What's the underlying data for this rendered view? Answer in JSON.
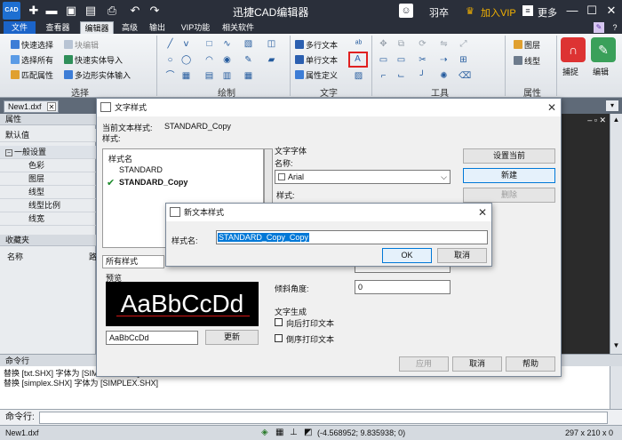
{
  "app": {
    "logo": "CAD",
    "title": "迅捷CAD编辑器",
    "user": "羽卒",
    "vip": "加入VIP",
    "more": "更多"
  },
  "menu_tabs": [
    "文件",
    "查看器",
    "编辑器",
    "高级",
    "输出",
    "VIP功能",
    "相关软件"
  ],
  "ribbon": {
    "select_group": {
      "label": "选择",
      "items": [
        "快速选择",
        "选择所有",
        "匹配属性",
        "块编辑",
        "快速实体导入",
        "多边形实体输入"
      ]
    },
    "draw_group": {
      "label": "绘制"
    },
    "text_group": {
      "label": "文字",
      "items": [
        "多行文本",
        "单行文本",
        "属性定义"
      ]
    },
    "tools_group": {
      "label": "工具"
    },
    "props_group": {
      "label": "属性",
      "items": [
        "图层",
        "线型"
      ]
    },
    "right_buttons": [
      "捕捉",
      "编辑"
    ]
  },
  "doc_tab": {
    "name": "New1.dxf"
  },
  "left_panel": {
    "header": "属性",
    "default_label": "默认值",
    "section": "一般设置",
    "rows": [
      "色彩",
      "图层",
      "线型",
      "线型比例",
      "线宽"
    ],
    "favorites_header": "收藏夹",
    "fav_col1": "名称",
    "fav_col2": "路"
  },
  "text_style_dialog": {
    "title": "文字样式",
    "current_label": "当前文本样式:",
    "current_value": "STANDARD_Copy",
    "styles_label": "样式:",
    "list_header": "样式名",
    "styles": [
      "STANDARD",
      "STANDARD_Copy"
    ],
    "filter_value": "所有样式",
    "preview_label": "预览",
    "preview_text": "AaBbCcDd",
    "preview_input": "AaBbCcDd",
    "refresh_button": "更新",
    "font_group": "文字字体",
    "name_label": "名称:",
    "font_value": "Arial",
    "style_label": "样式:",
    "oblique_label": "倾斜角度:",
    "oblique_value": "0",
    "gen_group": "文字生成",
    "backward": "向后打印文本",
    "upside_down": "倒序打印文本",
    "set_current": "设置当前",
    "new_button": "新建",
    "delete_button": "删除",
    "apply_button": "应用",
    "cancel_button": "取消",
    "help_button": "帮助"
  },
  "new_style_dialog": {
    "title": "新文本样式",
    "name_label": "样式名:",
    "name_value": "STANDARD_Copy_Copy",
    "ok": "OK",
    "cancel": "取消"
  },
  "command": {
    "header": "命令行",
    "log": [
      "替换 [txt.SHX] 字体为 [SIMPLEX.SHX]",
      "替换 [simplex.SHX] 字体为 [SIMPLEX.SHX]"
    ],
    "prompt": "命令行:"
  },
  "status": {
    "doc": "New1.dxf",
    "coords": "(-4.568952; 9.835938; 0)",
    "size": "297 x 210 x 0"
  },
  "colors": {
    "titlebar": "#2a2f3a",
    "accent": "#1b64c9",
    "vip": "#f5b301",
    "highlight_box": "#e02020"
  }
}
